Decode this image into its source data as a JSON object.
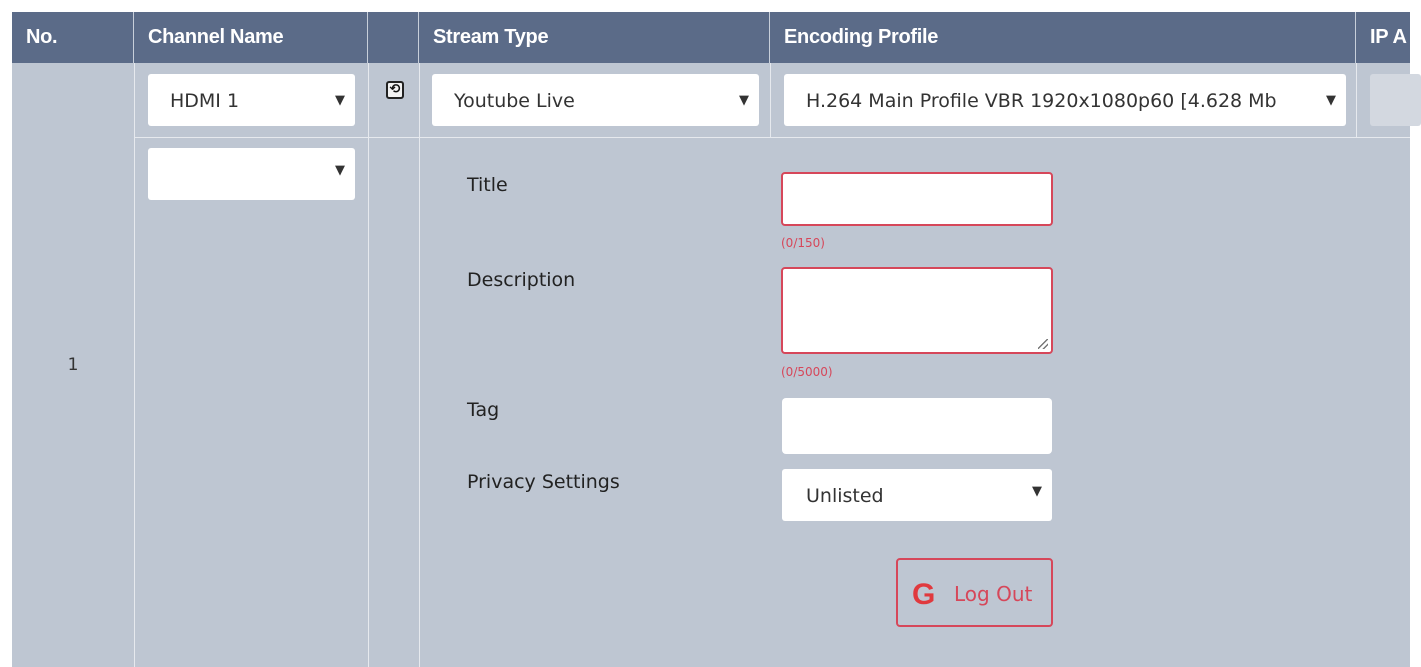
{
  "header": {
    "no": "No.",
    "channel_name": "Channel Name",
    "stream_type": "Stream Type",
    "encoding_profile": "Encoding Profile",
    "ip": "IP A"
  },
  "row": {
    "number": "1",
    "channel_select": "HDMI 1",
    "channel_select2": "",
    "stream_type_select": "Youtube Live",
    "encoding_select": "H.264 Main Profile VBR 1920x1080p60 [4.628 Mb",
    "dropdown_arrow": "▼"
  },
  "form": {
    "title_label": "Title",
    "title_value": "",
    "title_counter": "(0/150)",
    "description_label": "Description",
    "description_value": "",
    "description_counter": "(0/5000)",
    "tag_label": "Tag",
    "tag_value": "",
    "privacy_label": "Privacy Settings",
    "privacy_value": "Unlisted",
    "logout_icon": "G",
    "logout_label": "Log Out"
  },
  "colors": {
    "header_bg": "#5b6b88",
    "body_bg": "#bec6d2",
    "error_red": "#d6475a"
  }
}
